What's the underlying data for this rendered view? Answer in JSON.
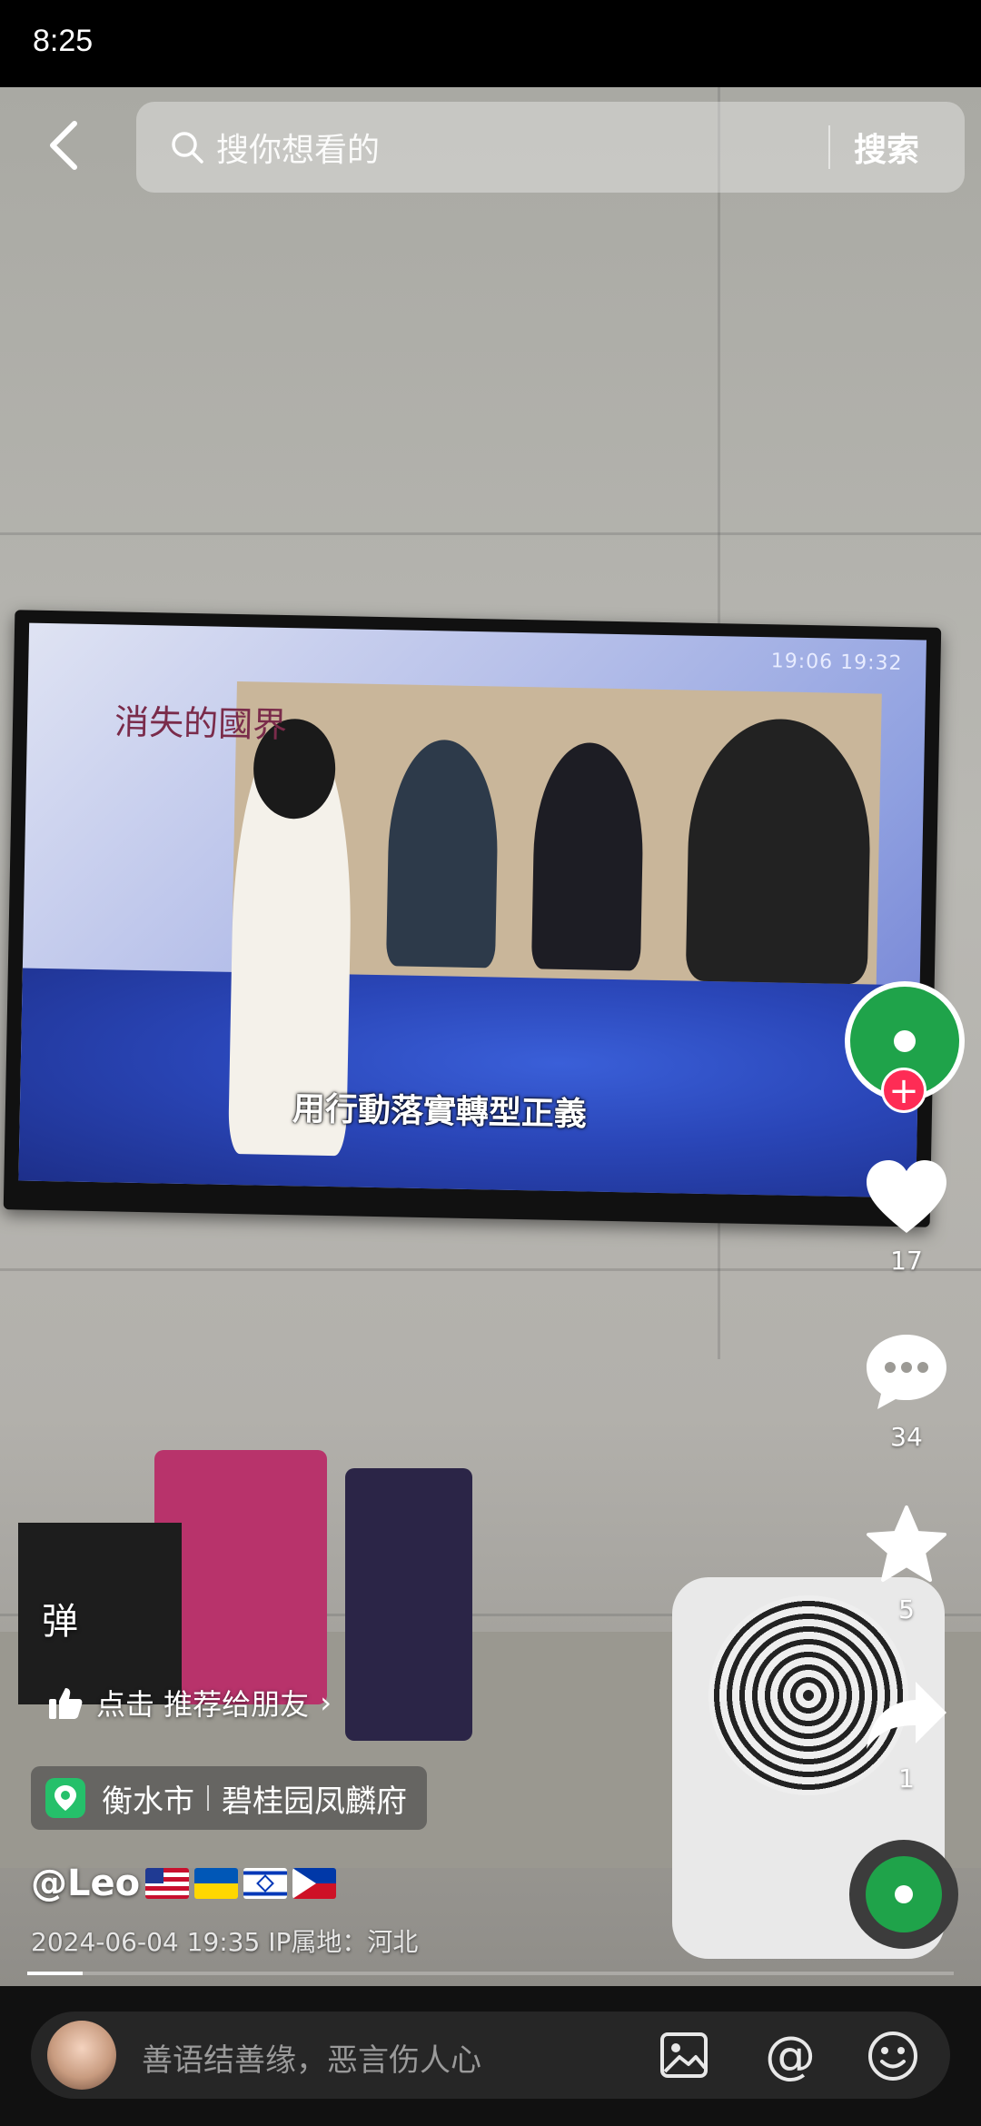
{
  "status_bar": {
    "time": "8:25"
  },
  "search": {
    "placeholder": "搜你想看的",
    "button_label": "搜索"
  },
  "video": {
    "tv_channel_title": "消失的國界",
    "tv_clock": "19:06  19:32",
    "tv_subtitle": "用行動落實轉型正義"
  },
  "actions": {
    "likes": "17",
    "comments": "34",
    "favorites": "5",
    "shares": "1"
  },
  "overlay": {
    "danmu_label": "弹",
    "recommend_text": "点击 推荐给朋友",
    "location_city": "衡水市",
    "location_place": "碧桂园凤麟府",
    "author": "@Leo",
    "post_meta": "2024-06-04 19:35  IP属地：河北"
  },
  "playback": {
    "progress": 0.06
  },
  "comment_bar": {
    "placeholder": "善语结善缘，恶言伤人心"
  },
  "icons": [
    "back-icon",
    "search-icon",
    "heart-icon",
    "comment-icon",
    "star-icon",
    "share-icon",
    "thumbs-up-icon",
    "location-pin-icon",
    "image-icon",
    "mention-icon",
    "emoji-icon"
  ],
  "colors": {
    "accent": "#fe2c55",
    "location_green": "#25c06a",
    "avatar_green": "#1fa34a"
  }
}
